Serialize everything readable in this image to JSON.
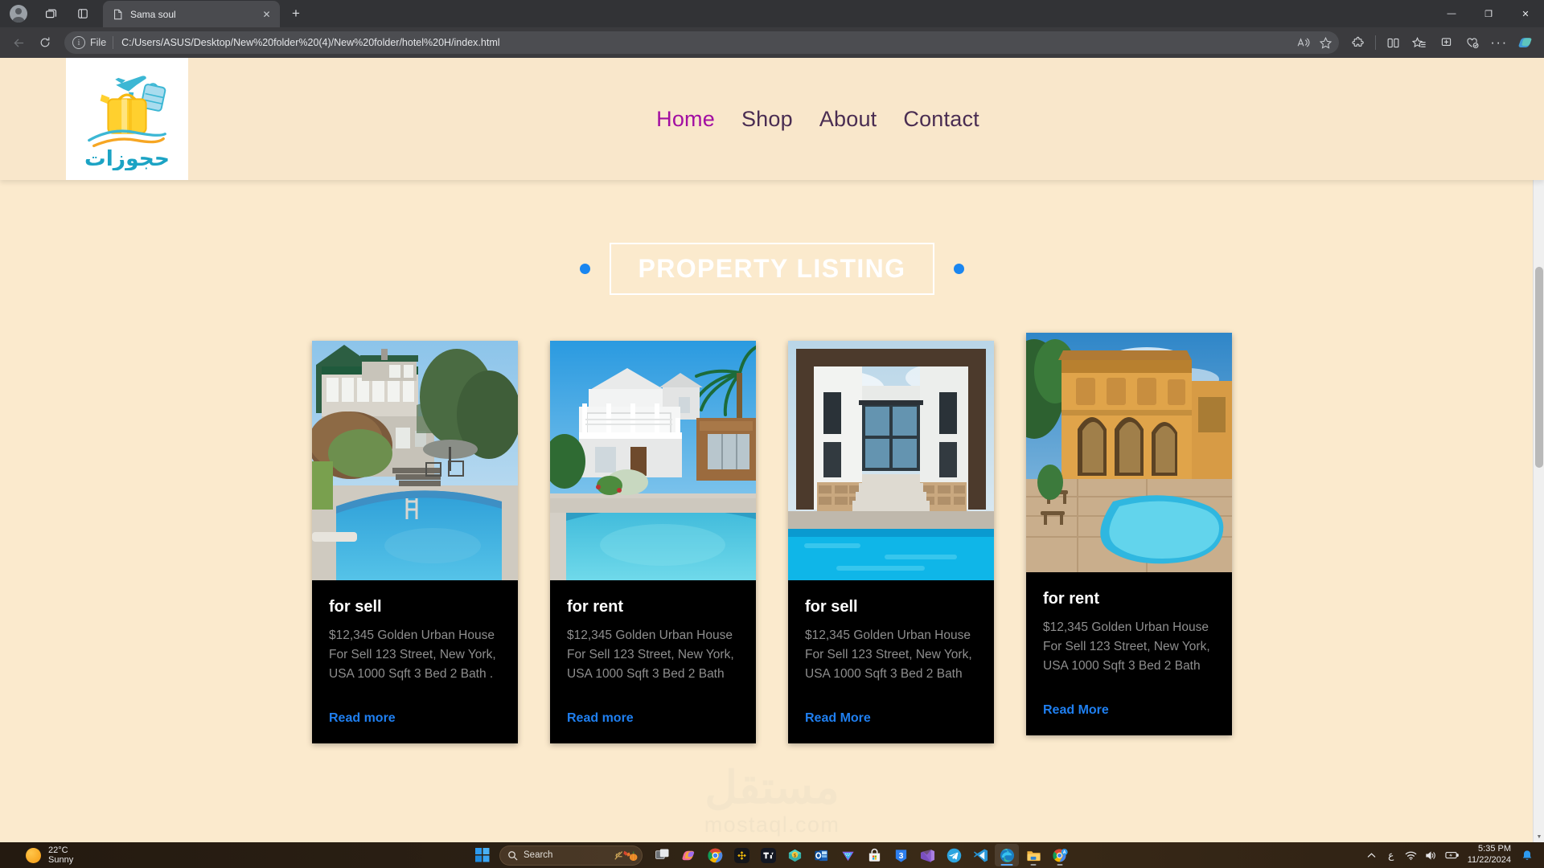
{
  "browser": {
    "tab": {
      "title": "Sama soul",
      "favicon_icon": "page-icon",
      "close_icon": "close-icon"
    },
    "new_tab_label": "+",
    "window_controls": {
      "minimize": "—",
      "maximize": "❐",
      "close": "✕"
    },
    "toolbar_left": {
      "back_icon": "back-arrow-icon",
      "refresh_icon": "refresh-icon"
    },
    "omnibox": {
      "info_icon": "info-icon",
      "scheme_label": "File",
      "url": "C:/Users/ASUS/Desktop/New%20folder%20(4)/New%20folder/hotel%20H/index.html",
      "read_aloud_icon": "read-aloud-icon",
      "favorite_icon": "star-icon"
    },
    "toolbar_right": [
      {
        "name": "extensions-icon",
        "glyph": "puzzle"
      },
      {
        "name": "split-screen-icon",
        "glyph": "split"
      },
      {
        "name": "favorites-icon",
        "glyph": "star-list"
      },
      {
        "name": "collections-icon",
        "glyph": "collections"
      },
      {
        "name": "browser-essentials-icon",
        "glyph": "essentials"
      },
      {
        "name": "settings-more-icon",
        "glyph": "..."
      },
      {
        "name": "copilot-icon",
        "glyph": "copilot"
      }
    ]
  },
  "site": {
    "logo": {
      "name": "hojozat-logo",
      "brand_text": "حجوزات",
      "alt": "suitcase and airplane travel booking logo"
    },
    "nav": [
      {
        "label": "Home",
        "active": true
      },
      {
        "label": "Shop",
        "active": false
      },
      {
        "label": "About",
        "active": false
      },
      {
        "label": "Contact",
        "active": false
      }
    ],
    "section": {
      "title": "PROPERTY LISTING",
      "dot_color": "#1a86f0",
      "title_color": "#ffffff"
    },
    "cards": [
      {
        "tag": "for sell",
        "description": "$12,345 Golden Urban House For Sell 123 Street, New York, USA 1000 Sqft 3 Bed 2 Bath .",
        "link": "Read more",
        "image_alt": "two-storey grey house with green roof and backyard swimming pool"
      },
      {
        "tag": "for rent",
        "description": "$12,345 Golden Urban House For Sell 123 Street, New York, USA 1000 Sqft 3 Bed 2 Bath",
        "link": "Read more",
        "image_alt": "white two-storey house with balcony, palm tree and pool"
      },
      {
        "tag": "for sell",
        "description": "$12,345 Golden Urban House For Sell 123 Street, New York, USA 1000 Sqft 3 Bed 2 Bath",
        "link": "Read More",
        "image_alt": "modern white and wood villa with glass facade and pool"
      },
      {
        "tag": "for rent",
        "description": "$12,345 Golden Urban House For Sell 123 Street, New York, USA 1000 Sqft 3 Bed 2 Bath",
        "link": "Read More",
        "image_alt": "ochre mediterranean villa with arched terrace and curved pool"
      }
    ],
    "watermark": {
      "arabic": "مستقل",
      "latin": "mostaql.com"
    },
    "colors": {
      "page_background": "#fbeacd",
      "header_background": "#f9e7cb",
      "nav_active": "#a20ea2",
      "nav_default": "#4a2d52",
      "card_background": "#000000",
      "card_link": "#1f7ff0",
      "card_desc": "#8e8e8e"
    }
  },
  "taskbar": {
    "weather": {
      "temperature": "22°C",
      "condition": "Sunny",
      "icon": "sun-icon"
    },
    "start_icon": "windows-start-icon",
    "search": {
      "placeholder": "Search",
      "icon": "search-icon",
      "decoration_icon": "autumn-pumpkin-icon"
    },
    "task_view_icon": "task-view-icon",
    "apps": [
      {
        "name": "microsoft-copilot-icon",
        "running": false
      },
      {
        "name": "google-chrome-icon",
        "running": false
      },
      {
        "name": "binance-icon",
        "running": false
      },
      {
        "name": "tradingview-icon",
        "running": false
      },
      {
        "name": "money-manager-icon",
        "running": false
      },
      {
        "name": "outlook-icon",
        "running": false
      },
      {
        "name": "purple-triangle-app-icon",
        "running": false
      },
      {
        "name": "microsoft-store-icon",
        "running": false
      },
      {
        "name": "badge-3-app-icon",
        "running": false
      },
      {
        "name": "visual-studio-icon",
        "running": false
      },
      {
        "name": "telegram-icon",
        "running": false
      },
      {
        "name": "vscode-icon",
        "running": false
      },
      {
        "name": "microsoft-edge-icon",
        "running": true
      },
      {
        "name": "file-explorer-icon",
        "running": true
      },
      {
        "name": "chrome-shortcut-icon",
        "running": true
      }
    ],
    "tray": {
      "overflow_icon": "chevron-up-icon",
      "language": "ع",
      "wifi_icon": "wifi-icon",
      "volume_icon": "volume-icon",
      "battery_icon": "battery-charging-icon",
      "time": "5:35 PM",
      "date": "11/22/2024",
      "notification_icon": "bell-icon"
    }
  }
}
